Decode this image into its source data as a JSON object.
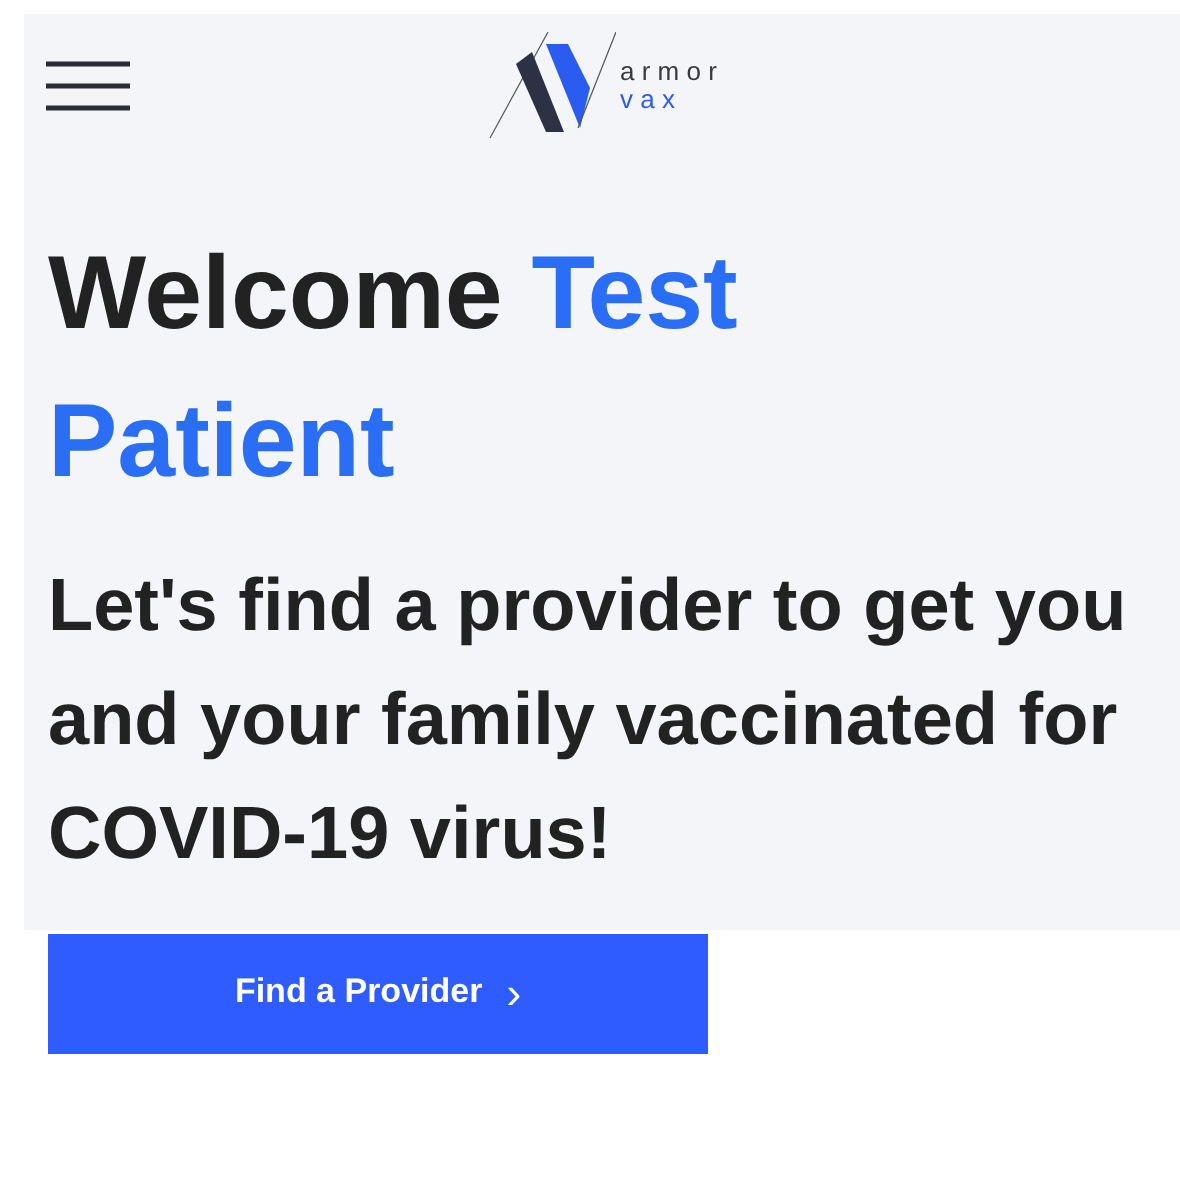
{
  "header": {
    "logo": {
      "line_1": "a r m o r",
      "line_2": "v a x"
    }
  },
  "welcome": {
    "greeting": "Welcome",
    "name": "Test Patient"
  },
  "subheading": "Let's find a provider to get you and your family vaccinated for COVID-19 virus!",
  "button": {
    "label": "Find a Provider",
    "icon": "›"
  }
}
